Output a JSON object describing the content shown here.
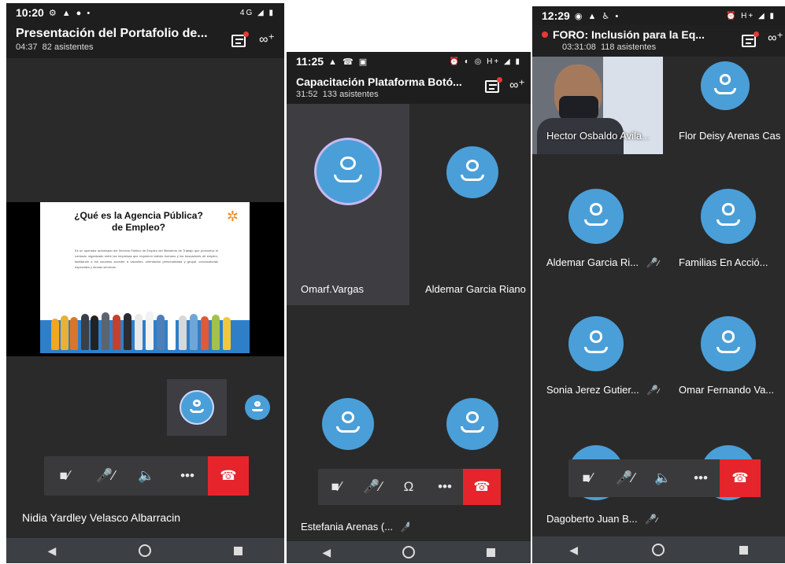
{
  "phone1": {
    "status": {
      "time": "10:20",
      "left_icons": "⚙ ▲ ● •",
      "right_icons": "4G ◢ ▮"
    },
    "header": {
      "title": "Presentación del Portafolio de...",
      "elapsed": "04:37",
      "attendees": "82 asistentes"
    },
    "slide": {
      "title_line1": "¿Qué es la Agencia Pública?",
      "title_line2": "de Empleo?",
      "body": "Es un operador autorizado del Servicio Público de Empleo del Ministerio de Trabajo que promueve el contacto organizado entre las empresas que requieren talento humano y los buscadores de empleo, facilitando a los usuarios acceder a vacantes, orientación personalizada y grupal, convocatorias especiales y demas servicios."
    },
    "presenter_name": "Nidia Yardley Velasco Albarracin"
  },
  "phone2": {
    "status": {
      "time": "11:25",
      "left_icons": "▲ ☎ ▣",
      "right_icons": "⏰ ◐ ◎ H+ ◢ ▮"
    },
    "header": {
      "title": "Capacitación Plataforma Botó...",
      "elapsed": "31:52",
      "attendees": "133 asistentes"
    },
    "tiles": [
      {
        "name": "Omarf.Vargas"
      },
      {
        "name": "Aldemar  Garcia Riano"
      },
      {
        "name": "Estefania Arenas (..."
      },
      {
        "name": ""
      }
    ]
  },
  "phone3": {
    "status": {
      "time": "12:29",
      "left_icons": "◉ ▲ ♿ •",
      "right_icons": "⏰ H+ ◢ ▮"
    },
    "header": {
      "title": "FORO: Inclusión para la Eq...",
      "elapsed": "03:31:08",
      "attendees": "118 asistentes"
    },
    "tiles": [
      {
        "name": "Hector Osbaldo Avila..."
      },
      {
        "name": "Flor Deisy Arenas Cas"
      },
      {
        "name": "Aldemar  Garcia Ri..."
      },
      {
        "name": "Familias En Acció..."
      },
      {
        "name": "Sonia Jerez Gutier..."
      },
      {
        "name": "Omar Fernando Va..."
      },
      {
        "name": "Dagoberto Juan B..."
      },
      {
        "name": ""
      }
    ]
  },
  "colors": {
    "avatar": "#4a9fd8",
    "hangup": "#e5252b",
    "background": "#2a2a2b",
    "recording": "#e53935"
  },
  "icons": {
    "camera_off": "camera-off-icon",
    "mic_off": "mic-off-icon",
    "speaker": "speaker-icon",
    "headset": "headset-icon",
    "more": "more-icon",
    "hangup": "hangup-icon"
  }
}
